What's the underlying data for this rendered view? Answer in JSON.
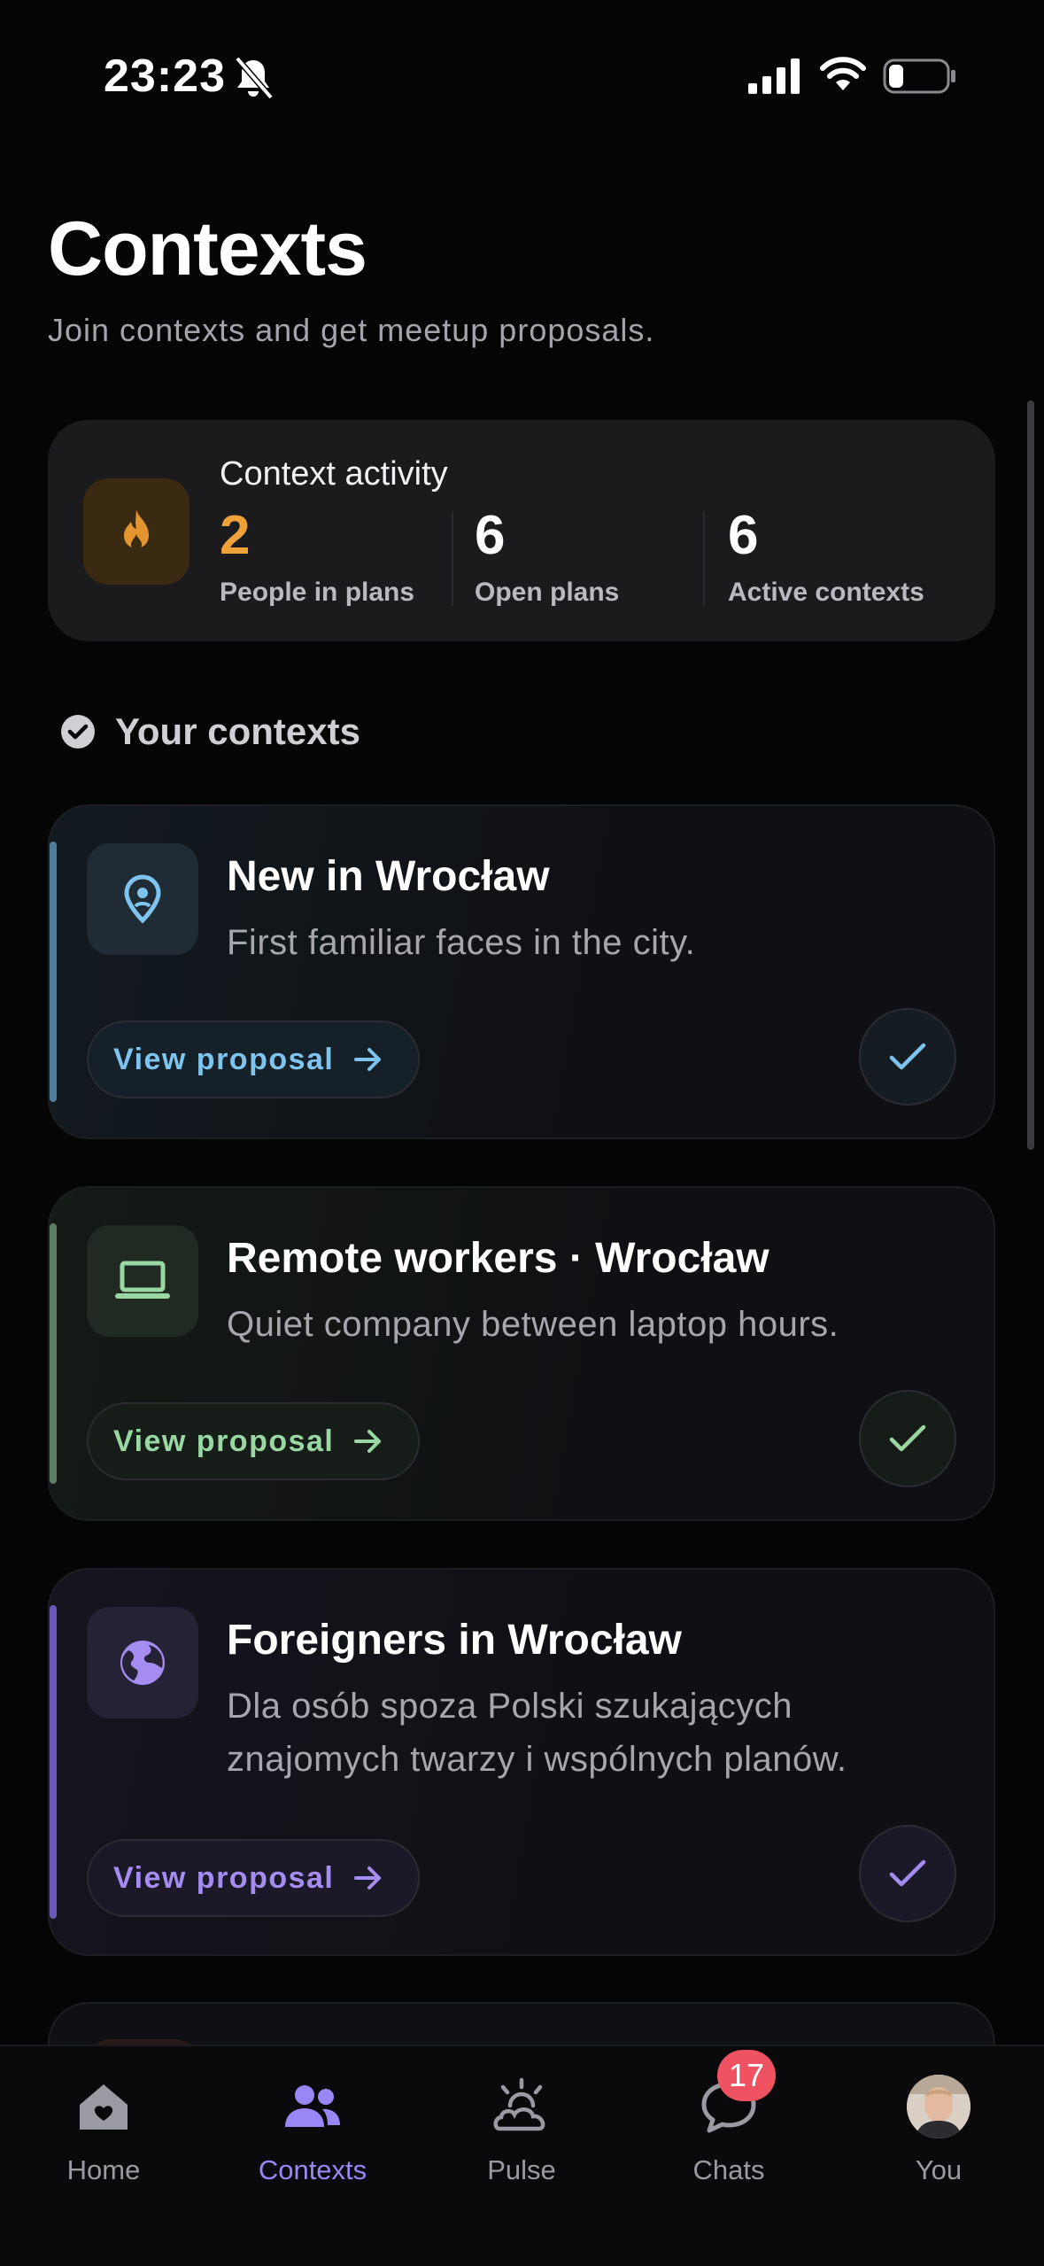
{
  "status_bar": {
    "time": "23:23"
  },
  "header": {
    "title": "Contexts",
    "subtitle": "Join contexts and get meetup proposals."
  },
  "activity": {
    "title": "Context activity",
    "stats": [
      {
        "value": "2",
        "label": "People in plans",
        "color": "#f0a23a"
      },
      {
        "value": "6",
        "label": "Open plans",
        "color": "#ffffff"
      },
      {
        "value": "6",
        "label": "Active contexts",
        "color": "#ffffff"
      }
    ]
  },
  "section": {
    "title": "Your contexts"
  },
  "contexts": [
    {
      "title": "New in Wrocław",
      "description": "First familiar faces in the city.",
      "button": "View proposal",
      "icon": "location-pin-icon",
      "accent": "#7fc4ef"
    },
    {
      "title": "Remote workers · Wrocław",
      "description": "Quiet company between laptop hours.",
      "button": "View proposal",
      "icon": "laptop-icon",
      "accent": "#9ad8a3"
    },
    {
      "title": "Foreigners in Wrocław",
      "description": "Dla osób spoza Polski szukających znajomych twarzy i wspólnych planów.",
      "button": "View proposal",
      "icon": "globe-icon",
      "accent": "#a48cf0"
    }
  ],
  "tabs": [
    {
      "label": "Home",
      "icon": "home-heart-icon",
      "active": false
    },
    {
      "label": "Contexts",
      "icon": "people-icon",
      "active": true
    },
    {
      "label": "Pulse",
      "icon": "sun-cloud-icon",
      "active": false
    },
    {
      "label": "Chats",
      "icon": "chat-bubble-icon",
      "active": false,
      "badge": "17"
    },
    {
      "label": "You",
      "icon": "avatar",
      "active": false
    }
  ],
  "colors": {
    "active_tab": "#9b86f5",
    "inactive_tab": "#9a9aa2"
  }
}
